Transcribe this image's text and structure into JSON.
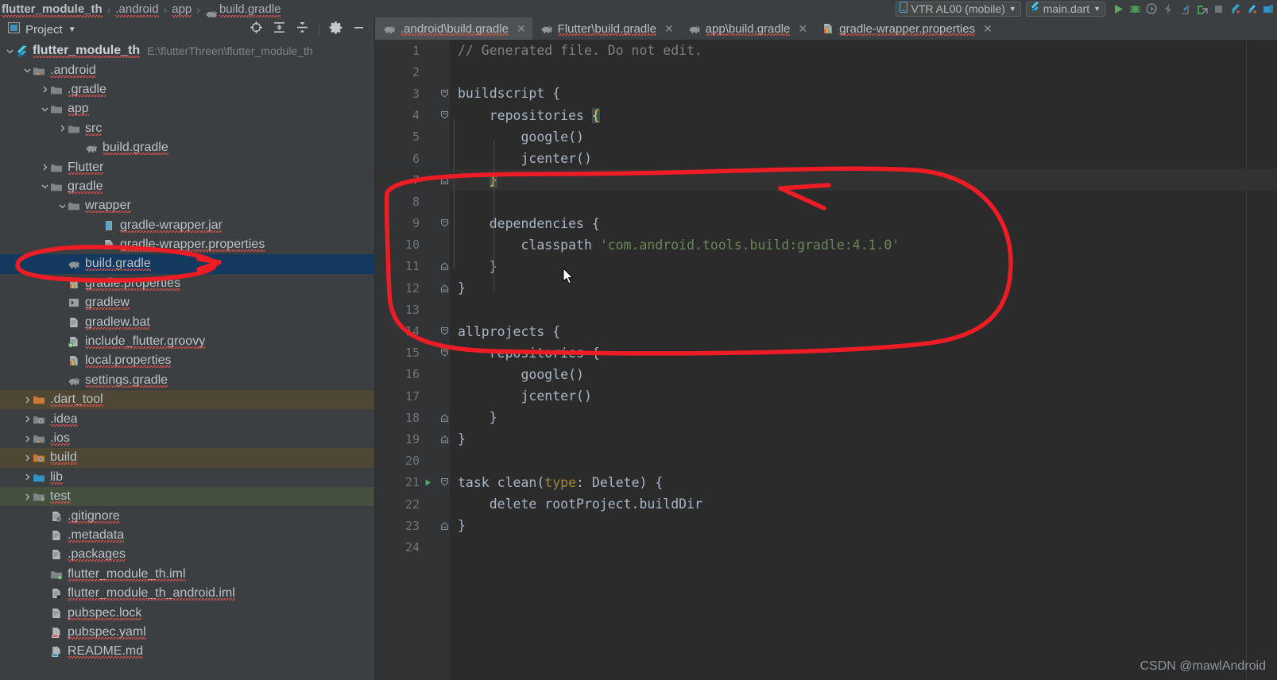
{
  "breadcrumb": {
    "items": [
      {
        "label": "flutter_module_th",
        "bold": true,
        "icon": "none"
      },
      {
        "label": ".android",
        "bold": false,
        "icon": "none"
      },
      {
        "label": "app",
        "bold": false,
        "icon": "none"
      },
      {
        "label": "build.gradle",
        "bold": false,
        "icon": "gradle-icon"
      }
    ],
    "separator": "›"
  },
  "toolbar": {
    "device_selector": {
      "label": "VTR AL00 (mobile)",
      "icon": "phone-icon",
      "carat": "▼"
    },
    "run_config": {
      "label": "main.dart",
      "icon": "flutter-icon",
      "carat": "▼"
    },
    "buttons": [
      {
        "name": "run-button",
        "icon": "play-icon",
        "color": "#59a869"
      },
      {
        "name": "debug-button",
        "icon": "bug-icon",
        "color": "#499c54"
      },
      {
        "name": "run-with-coverage-button",
        "icon": "coverage-icon",
        "color": "#6e7679"
      },
      {
        "name": "hot-reload-button",
        "icon": "lightning-icon",
        "color": "#6e7679"
      },
      {
        "name": "flutter-hot-restart-button",
        "icon": "hot-restart-icon",
        "color": "#3592c4"
      },
      {
        "name": "open-devtools-button",
        "icon": "devtools-icon",
        "color": "#499c54"
      },
      {
        "name": "stop-button",
        "icon": "stop-square-icon",
        "color": "#6e7679"
      },
      {
        "name": "flutter-attach-button",
        "icon": "flutter-attach-icon",
        "color": "#3592c4"
      },
      {
        "name": "flutter-detach-button",
        "icon": "flutter-detach-icon",
        "color": "#3592c4"
      },
      {
        "name": "device-manager-button",
        "icon": "device-manager-icon",
        "color": "#3592c4"
      }
    ]
  },
  "project_panel": {
    "title": "Project",
    "carat": "▼",
    "actions": [
      {
        "name": "select-opened-file-button",
        "icon": "target-icon"
      },
      {
        "name": "expand-all-button",
        "icon": "expand-all-icon"
      },
      {
        "name": "collapse-all-button",
        "icon": "collapse-all-icon"
      },
      {
        "name": "settings-button",
        "icon": "gear-icon"
      },
      {
        "name": "hide-button",
        "icon": "minimize-icon"
      }
    ],
    "tree": [
      {
        "label": "flutter_module_th",
        "sublabel": "E:\\flutterThreen\\flutter_module_th",
        "indent": 0,
        "arrow": "down",
        "icon": "flutter-icon",
        "bold": true,
        "state": "normal"
      },
      {
        "label": ".android",
        "sublabel": "",
        "indent": 1,
        "arrow": "down",
        "icon": "android-folder-icon",
        "bold": false,
        "state": "normal"
      },
      {
        "label": ".gradle",
        "sublabel": "",
        "indent": 2,
        "arrow": "right",
        "icon": "folder-icon",
        "bold": false,
        "state": "normal"
      },
      {
        "label": "app",
        "sublabel": "",
        "indent": 2,
        "arrow": "down",
        "icon": "folder-icon",
        "bold": false,
        "state": "normal"
      },
      {
        "label": "src",
        "sublabel": "",
        "indent": 3,
        "arrow": "right",
        "icon": "folder-icon",
        "bold": false,
        "state": "normal"
      },
      {
        "label": "build.gradle",
        "sublabel": "",
        "indent": 4,
        "arrow": "none",
        "icon": "gradle-icon",
        "bold": false,
        "state": "normal"
      },
      {
        "label": "Flutter",
        "sublabel": "",
        "indent": 2,
        "arrow": "right",
        "icon": "folder-icon",
        "bold": false,
        "state": "normal"
      },
      {
        "label": "gradle",
        "sublabel": "",
        "indent": 2,
        "arrow": "down",
        "icon": "folder-icon",
        "bold": false,
        "state": "normal"
      },
      {
        "label": "wrapper",
        "sublabel": "",
        "indent": 3,
        "arrow": "down",
        "icon": "folder-icon",
        "bold": false,
        "state": "normal"
      },
      {
        "label": "gradle-wrapper.jar",
        "sublabel": "",
        "indent": 5,
        "arrow": "none",
        "icon": "jar-icon",
        "bold": false,
        "state": "normal"
      },
      {
        "label": "gradle-wrapper.properties",
        "sublabel": "",
        "indent": 5,
        "arrow": "none",
        "icon": "properties-icon",
        "bold": false,
        "state": "normal"
      },
      {
        "label": "build.gradle",
        "sublabel": "",
        "indent": 3,
        "arrow": "none",
        "icon": "gradle-icon",
        "bold": false,
        "state": "selected"
      },
      {
        "label": "gradle.properties",
        "sublabel": "",
        "indent": 3,
        "arrow": "none",
        "icon": "properties-icon",
        "bold": false,
        "state": "normal"
      },
      {
        "label": "gradlew",
        "sublabel": "",
        "indent": 3,
        "arrow": "none",
        "icon": "script-icon",
        "bold": false,
        "state": "normal"
      },
      {
        "label": "gradlew.bat",
        "sublabel": "",
        "indent": 3,
        "arrow": "none",
        "icon": "text-file-icon",
        "bold": false,
        "state": "normal"
      },
      {
        "label": "include_flutter.groovy",
        "sublabel": "",
        "indent": 3,
        "arrow": "none",
        "icon": "groovy-icon",
        "bold": false,
        "state": "normal"
      },
      {
        "label": "local.properties",
        "sublabel": "",
        "indent": 3,
        "arrow": "none",
        "icon": "properties-icon",
        "bold": false,
        "state": "normal"
      },
      {
        "label": "settings.gradle",
        "sublabel": "",
        "indent": 3,
        "arrow": "none",
        "icon": "gradle-icon",
        "bold": false,
        "state": "normal"
      },
      {
        "label": ".dart_tool",
        "sublabel": "",
        "indent": 1,
        "arrow": "right",
        "icon": "excluded-folder-icon",
        "bold": false,
        "state": "excluded"
      },
      {
        "label": ".idea",
        "sublabel": "",
        "indent": 1,
        "arrow": "right",
        "icon": "idea-folder-icon",
        "bold": false,
        "state": "normal"
      },
      {
        "label": ".ios",
        "sublabel": "",
        "indent": 1,
        "arrow": "right",
        "icon": "android-folder-icon",
        "bold": false,
        "state": "normal"
      },
      {
        "label": "build",
        "sublabel": "",
        "indent": 1,
        "arrow": "right",
        "icon": "excluded-idea-folder-icon",
        "bold": false,
        "state": "excluded"
      },
      {
        "label": "lib",
        "sublabel": "",
        "indent": 1,
        "arrow": "right",
        "icon": "source-folder-icon",
        "bold": false,
        "state": "normal"
      },
      {
        "label": "test",
        "sublabel": "",
        "indent": 1,
        "arrow": "right",
        "icon": "test-folder-icon",
        "bold": false,
        "state": "test"
      },
      {
        "label": ".gitignore",
        "sublabel": "",
        "indent": 2,
        "arrow": "none",
        "icon": "gitignore-icon",
        "bold": false,
        "state": "normal"
      },
      {
        "label": ".metadata",
        "sublabel": "",
        "indent": 2,
        "arrow": "none",
        "icon": "text-file-icon",
        "bold": false,
        "state": "normal"
      },
      {
        "label": ".packages",
        "sublabel": "",
        "indent": 2,
        "arrow": "none",
        "icon": "text-file-icon",
        "bold": false,
        "state": "normal"
      },
      {
        "label": "flutter_module_th.iml",
        "sublabel": "",
        "indent": 2,
        "arrow": "none",
        "icon": "module-icon",
        "bold": false,
        "state": "normal"
      },
      {
        "label": "flutter_module_th_android.iml",
        "sublabel": "",
        "indent": 2,
        "arrow": "none",
        "icon": "module-file-icon",
        "bold": false,
        "state": "normal"
      },
      {
        "label": "pubspec.lock",
        "sublabel": "",
        "indent": 2,
        "arrow": "none",
        "icon": "text-file-icon",
        "bold": false,
        "state": "normal"
      },
      {
        "label": "pubspec.yaml",
        "sublabel": "",
        "indent": 2,
        "arrow": "none",
        "icon": "yaml-icon",
        "bold": false,
        "state": "normal"
      },
      {
        "label": "README.md",
        "sublabel": "",
        "indent": 2,
        "arrow": "none",
        "icon": "markdown-icon",
        "bold": false,
        "state": "normal"
      }
    ]
  },
  "editor": {
    "tabs": [
      {
        "label": ".android\\build.gradle",
        "icon": "gradle-icon",
        "active": true,
        "closable": true
      },
      {
        "label": "Flutter\\build.gradle",
        "icon": "gradle-icon",
        "active": false,
        "closable": true
      },
      {
        "label": "app\\build.gradle",
        "icon": "gradle-icon",
        "active": false,
        "closable": true
      },
      {
        "label": "gradle-wrapper.properties",
        "icon": "properties-icon",
        "active": false,
        "closable": true
      }
    ],
    "current_line": 7,
    "lines": [
      {
        "n": 1,
        "fold": "none",
        "run": false,
        "text": "// Generated file. Do not edit.",
        "kind": "comment"
      },
      {
        "n": 2,
        "fold": "none",
        "run": false,
        "text": "",
        "kind": "plain"
      },
      {
        "n": 3,
        "fold": "open",
        "run": false,
        "text": "buildscript {",
        "kind": "plain"
      },
      {
        "n": 4,
        "fold": "open",
        "run": false,
        "text": "    repositories {",
        "kind": "brace-open-hl"
      },
      {
        "n": 5,
        "fold": "none",
        "run": false,
        "text": "        google()",
        "kind": "plain"
      },
      {
        "n": 6,
        "fold": "none",
        "run": false,
        "text": "        jcenter()",
        "kind": "plain"
      },
      {
        "n": 7,
        "fold": "close",
        "run": false,
        "text": "    }",
        "kind": "brace-close-hl"
      },
      {
        "n": 8,
        "fold": "none",
        "run": false,
        "text": "",
        "kind": "plain"
      },
      {
        "n": 9,
        "fold": "open",
        "run": false,
        "text": "    dependencies {",
        "kind": "plain"
      },
      {
        "n": 10,
        "fold": "none",
        "run": false,
        "text": "        classpath 'com.android.tools.build:gradle:4.1.0'",
        "kind": "classpath"
      },
      {
        "n": 11,
        "fold": "close",
        "run": false,
        "text": "    }",
        "kind": "plain"
      },
      {
        "n": 12,
        "fold": "close",
        "run": false,
        "text": "}",
        "kind": "plain"
      },
      {
        "n": 13,
        "fold": "none",
        "run": false,
        "text": "",
        "kind": "plain"
      },
      {
        "n": 14,
        "fold": "open",
        "run": false,
        "text": "allprojects {",
        "kind": "plain"
      },
      {
        "n": 15,
        "fold": "open",
        "run": false,
        "text": "    repositories {",
        "kind": "plain"
      },
      {
        "n": 16,
        "fold": "none",
        "run": false,
        "text": "        google()",
        "kind": "plain"
      },
      {
        "n": 17,
        "fold": "none",
        "run": false,
        "text": "        jcenter()",
        "kind": "plain"
      },
      {
        "n": 18,
        "fold": "close",
        "run": false,
        "text": "    }",
        "kind": "plain"
      },
      {
        "n": 19,
        "fold": "close",
        "run": false,
        "text": "}",
        "kind": "plain"
      },
      {
        "n": 20,
        "fold": "none",
        "run": false,
        "text": "",
        "kind": "plain"
      },
      {
        "n": 21,
        "fold": "open",
        "run": true,
        "text": "task clean(type: Delete) {",
        "kind": "taskclean"
      },
      {
        "n": 22,
        "fold": "none",
        "run": false,
        "text": "    delete rootProject.buildDir",
        "kind": "plain"
      },
      {
        "n": 23,
        "fold": "close",
        "run": false,
        "text": "}",
        "kind": "plain"
      },
      {
        "n": 24,
        "fold": "none",
        "run": false,
        "text": "",
        "kind": "plain"
      }
    ]
  },
  "annotation": {
    "color": "#ee1c24",
    "shapes": [
      "ellipse-around-build-gradle-tree-item",
      "arrow-to-editor",
      "large-ellipse-around-buildscript-block"
    ]
  },
  "watermark": {
    "text": "CSDN @mawlAndroid"
  },
  "colors": {
    "panel_bg": "#3c3f41",
    "editor_bg": "#2b2b2b",
    "gutter_bg": "#313335",
    "selection_bg": "#133a5e",
    "excluded_bg": "#4e4733",
    "test_bg": "#46503f",
    "annotation_red": "#ee1c24",
    "string_green": "#6a8759",
    "comment_gray": "#808080"
  }
}
